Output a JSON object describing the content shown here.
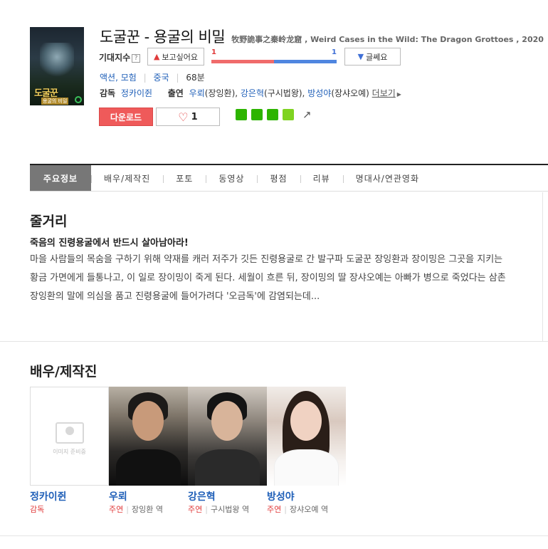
{
  "movie": {
    "poster_title": "도굴꾼",
    "poster_subtitle": "용굴의 비밀",
    "title": "도굴꾼 - 용굴의 비밀",
    "subtitle": "牧野詭事之秦岭龙窟 , Weird Cases in the Wild: The Dragon Grottoes , 2020"
  },
  "rating": {
    "expect_label": "기대지수",
    "help_icon": "?",
    "want_label": "보고싶어요",
    "want_count": "1",
    "meh_count": "1",
    "meh_label": "글쎄요",
    "want_ratio": 0.5
  },
  "info": {
    "genres": [
      {
        "label": "액션"
      },
      {
        "label": "모험"
      }
    ],
    "genre_sep": ",",
    "country": "중국",
    "runtime": "68분"
  },
  "credits": {
    "director_label": "감독",
    "director": "정카이쥔",
    "cast_label": "출연",
    "cast": [
      {
        "name": "우뢰",
        "role": "(장잉환)"
      },
      {
        "name": "강은혁",
        "role": "(구시법왕)"
      },
      {
        "name": "방성야",
        "role": "(장샤오예)"
      }
    ],
    "more_label": "더보기"
  },
  "actions": {
    "download_label": "다운로드",
    "like_count": "1"
  },
  "share": {
    "icons": [
      {
        "name": "blog-share-icon",
        "color": "#2db400"
      },
      {
        "name": "cafe-share-icon",
        "color": "#2db400"
      },
      {
        "name": "bookmark-share-icon",
        "color": "#2db400"
      },
      {
        "name": "memo-share-icon",
        "color": "#7fd321"
      }
    ]
  },
  "tabs": [
    {
      "label": "주요정보",
      "active": true
    },
    {
      "label": "배우/제작진"
    },
    {
      "label": "포토"
    },
    {
      "label": "동영상"
    },
    {
      "label": "평점"
    },
    {
      "label": "리뷰"
    },
    {
      "label": "명대사/연관영화"
    }
  ],
  "synopsis": {
    "title": "줄거리",
    "headline": "죽음의 진령용굴에서 반드시 살아남아라!",
    "body": "마을 사람들의 목숨을 구하기 위해 약재를 캐러 저주가 깃든 진령용굴로 간 발구파 도굴꾼 장잉환과 장이밍은 그곳을 지키는 황금 가면에게 들통나고, 이 일로 장이밍이 죽게 된다. 세월이 흐른 뒤, 장이밍의 딸 장샤오예는 아빠가 병으로 죽었다는 삼촌 장잉환의 말에 의심을 품고 진령용굴에 들어가려다 '오금독'에 감염되는데..."
  },
  "cast_section": {
    "title": "배우/제작진",
    "placeholder_text": "이미지 준비중",
    "members": [
      {
        "name": "정카이쥔",
        "type": "감독",
        "character": ""
      },
      {
        "name": "우뢰",
        "type": "주연",
        "character": "장잉환 역"
      },
      {
        "name": "강은혁",
        "type": "주연",
        "character": "구시법왕 역"
      },
      {
        "name": "방성야",
        "type": "주연",
        "character": "장샤오예 역"
      }
    ]
  },
  "colors": {
    "accent_red": "#ef5a5a",
    "link_blue": "#1f5fb8",
    "gauge_red": "#f06b6b",
    "gauge_blue": "#4f86e0"
  }
}
